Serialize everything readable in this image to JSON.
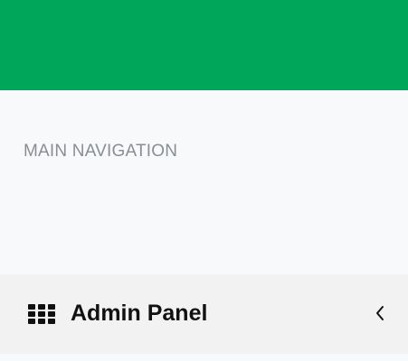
{
  "colors": {
    "topbar": "#00a65a",
    "sidebar_bg": "#f8f9fb",
    "item_bg": "#f2f2f2",
    "header_text": "#8a8e93",
    "item_text": "#111111"
  },
  "sidebar": {
    "header": "MAIN NAVIGATION",
    "items": [
      {
        "label": "Admin Panel",
        "icon": "grid-icon",
        "trailing_icon": "chevron-left-icon"
      }
    ]
  }
}
